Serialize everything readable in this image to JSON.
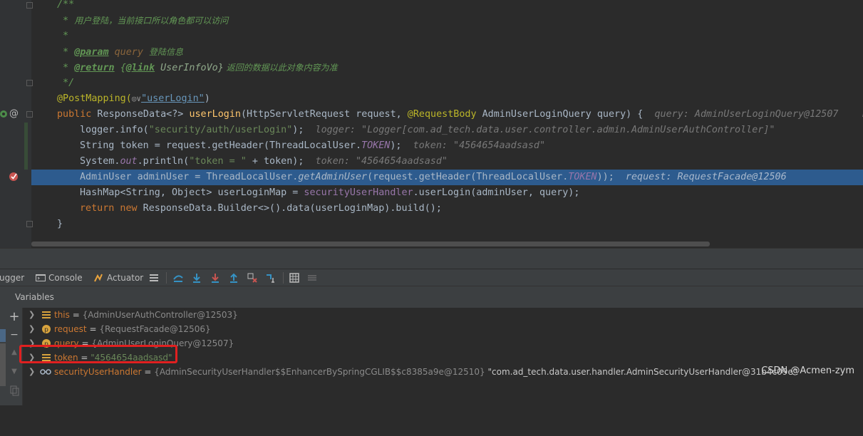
{
  "editor": {
    "lines": {
      "l1": "/**",
      "l2_star": " *",
      "l2_text": "用户登陆，当前接口所以角色都可以访问",
      "l3": " *",
      "l4_star": " * ",
      "l4_tag": "@param",
      "l4_name": "query",
      "l4_text": "登陆信息",
      "l5_star": " * ",
      "l5_tag": "@return",
      "l5_brace": "{",
      "l5_link": "@link",
      "l5_type": " UserInfoVo}",
      "l5_text": " 返回的数据以此对象内容为准",
      "l6": " */",
      "l7_ann": "@PostMapping(",
      "l7_icon": "◎∨",
      "l7_str": "\"userLogin\"",
      "l7_close": ")",
      "l8_kw": "public",
      "l8_type": " ResponseData<?> ",
      "l8_fn": "userLogin",
      "l8_params": "(HttpServletRequest request, ",
      "l8_ann": "@RequestBody",
      "l8_rest": " AdminUserLoginQuery query) {",
      "l8_hint": "query: AdminUserLoginQuery@12507    r",
      "l9_code": "logger.info(",
      "l9_str": "\"security/auth/userLogin\"",
      "l9_end": ");",
      "l9_hint": "logger: \"Logger[com.ad_tech.data.user.controller.admin.AdminUserAuthController]\"",
      "l10_code": "String token = request.getHeader(ThreadLocalUser.",
      "l10_const": "TOKEN",
      "l10_end": ");",
      "l10_hint": "token: \"4564654aadsasd\"",
      "l11_code": "System.",
      "l11_field": "out",
      "l11_mid": ".println(",
      "l11_str": "\"token = \"",
      "l11_end": " + token);",
      "l11_hint": "token: \"4564654aadsasd\"",
      "l12_code": "AdminUser adminUser = ThreadLocalUser.",
      "l12_fn": "getAdminUser",
      "l12_mid": "(request.getHeader(ThreadLocalUser.",
      "l12_const": "TOKEN",
      "l12_end": "));",
      "l12_hint": "request: RequestFacade@12506",
      "l13_code": "HashMap<String, Object> userLoginMap = ",
      "l13_field": "securityUserHandler",
      "l13_end": ".userLogin(adminUser, query);",
      "l14_kw": "return new",
      "l14_end": " ResponseData.Builder<>().data(userLoginMap).build();",
      "l15": "}"
    }
  },
  "toolbar": {
    "debugger_tab": "ugger",
    "console_tab": "Console",
    "actuator_tab": "Actuator"
  },
  "variables": {
    "header": "Variables",
    "items": [
      {
        "name": "this",
        "eq": " = ",
        "value": "{AdminUserAuthController@12503}",
        "icon": "field-icon"
      },
      {
        "name": "request",
        "eq": " = ",
        "value": "{RequestFacade@12506}",
        "icon": "param-icon"
      },
      {
        "name": "query",
        "eq": " = ",
        "value": "{AdminUserLoginQuery@12507}",
        "icon": "param-icon"
      },
      {
        "name": "token",
        "eq": " = ",
        "value": "\"4564654aadsasd\"",
        "icon": "field-icon"
      },
      {
        "name": "securityUserHandler",
        "eq": " = ",
        "value": "{AdminSecurityUserHandler$$EnhancerBySpringCGLIB$$c8385a9e@12510}",
        "extra": " \"com.ad_tech.data.user.handler.AdminSecurityUserHandler@31b4c09e\"",
        "icon": "watch-icon"
      }
    ]
  },
  "watermark": "CSDN @Acmen-zym",
  "colors": {
    "highlight": "#2d5b8e",
    "red_box": "#e02020",
    "keyword": "#cc7832",
    "string": "#6a8759",
    "comment": "#629755"
  }
}
